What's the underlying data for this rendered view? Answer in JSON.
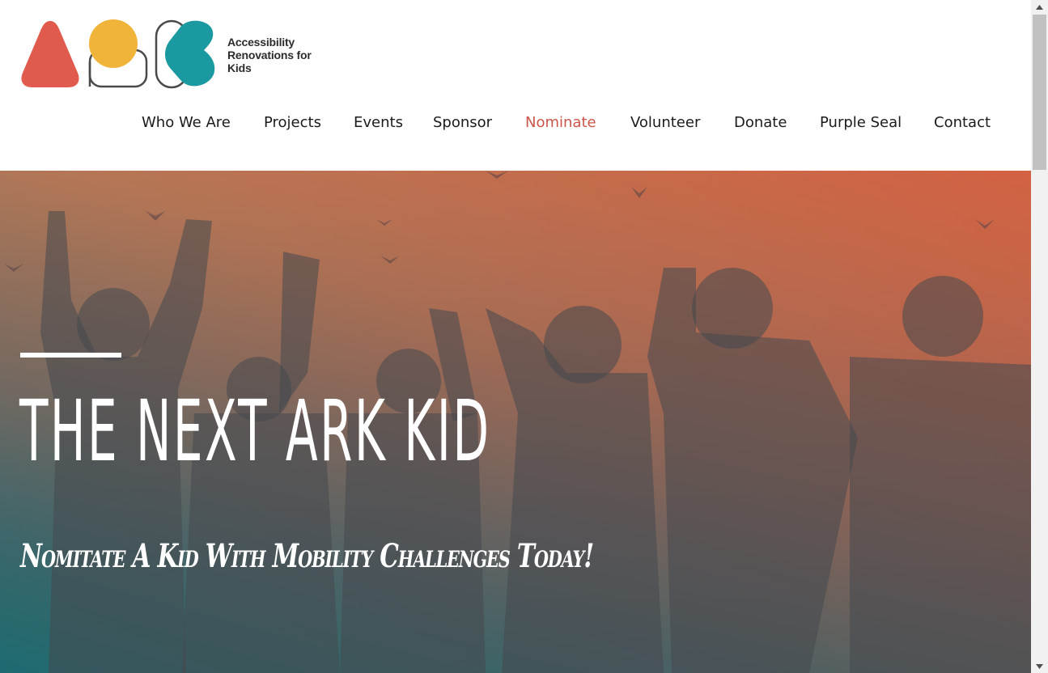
{
  "brand": {
    "name_lines": [
      "Accessibility",
      "Renovations for",
      "Kids"
    ],
    "colors": {
      "red": "#e05a4d",
      "yellow": "#f0b43a",
      "teal": "#1a9aa0",
      "outline": "#4a4a4a"
    }
  },
  "nav": {
    "items": [
      {
        "label": "Who We Are",
        "active": false
      },
      {
        "label": "Projects",
        "active": false
      },
      {
        "label": "Events",
        "active": false
      },
      {
        "label": "Sponsor",
        "active": false
      },
      {
        "label": "Nominate",
        "active": true
      },
      {
        "label": "Volunteer",
        "active": false
      },
      {
        "label": "Donate",
        "active": false
      },
      {
        "label": "Purple Seal",
        "active": false
      },
      {
        "label": "Contact",
        "active": false
      }
    ],
    "active_color": "#cc5449"
  },
  "hero": {
    "title": "THE NEXT ARK KID",
    "subtitle": "Nomitate A Kid With Mobility Challenges Today!"
  },
  "icons": {
    "scroll_up": "scroll-up-arrow-icon",
    "scroll_down": "scroll-down-arrow-icon"
  }
}
